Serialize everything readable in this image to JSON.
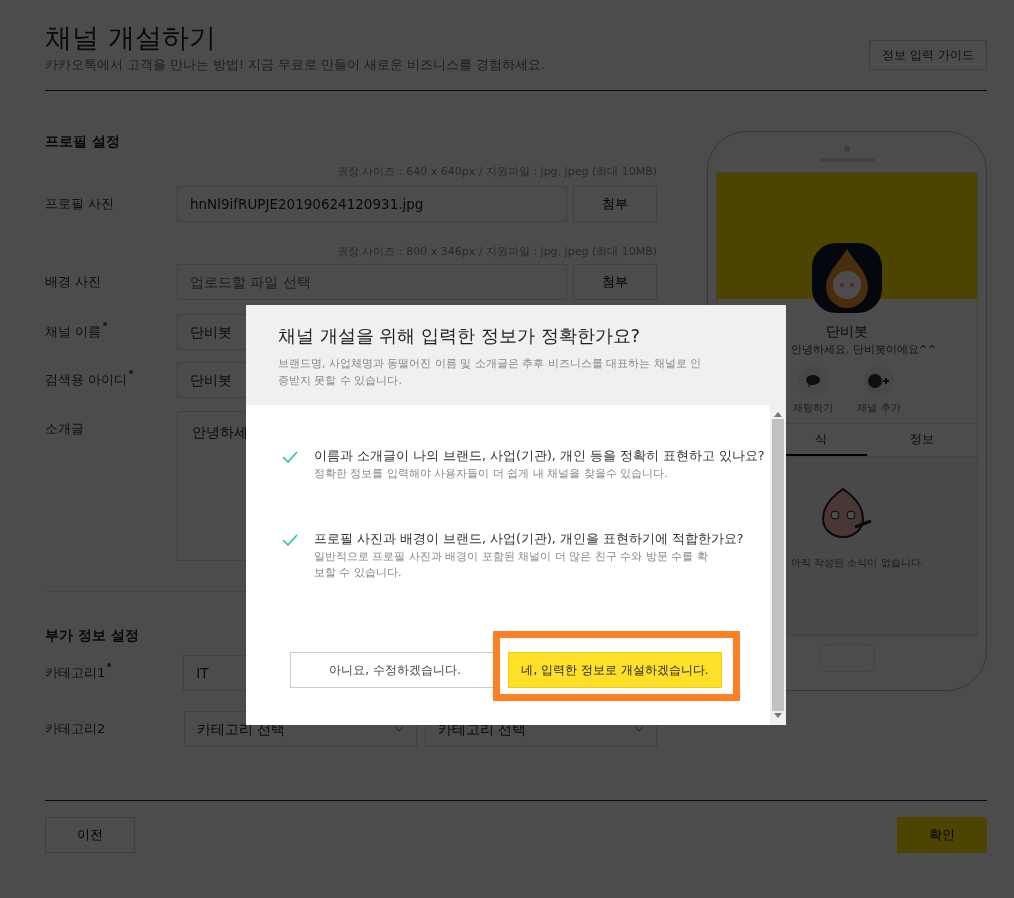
{
  "page": {
    "title": "채널 개설하기",
    "subtitle": "카카오톡에서 고객을 만나는 방법! 지금 무료로 만들어 새로운 비즈니스를 경험하세요.",
    "guide_button": "정보 입력 가이드"
  },
  "profile_section": {
    "heading": "프로필 설정",
    "fields": [
      {
        "kind": "file",
        "label": "프로필 사진",
        "required": false,
        "hint": "권장 사이즈 : 640 x 640px / 지원파일 : jpg, jpeg (최대 10MB)",
        "value": "hnNl9ifRUPJE20190624120931.jpg",
        "button": "첨부"
      },
      {
        "kind": "file",
        "label": "배경 사진",
        "required": false,
        "hint": "권장 사이즈 : 800 x 346px / 지원파일 : jpg, jpeg (최대 10MB)",
        "placeholder": "업로드할 파일 선택",
        "button": "첨부"
      },
      {
        "kind": "text",
        "label": "채널 이름",
        "required": true,
        "value": "단비봇"
      },
      {
        "kind": "text",
        "label": "검색용 아이디",
        "required": true,
        "value": "단비봇"
      },
      {
        "kind": "textarea",
        "label": "소개글",
        "required": false,
        "value": "안녕하세"
      }
    ]
  },
  "extra_section": {
    "heading": "부가 정보 설정",
    "fields": [
      {
        "kind": "select",
        "label": "카테고리1",
        "required": true,
        "selects": [
          "IT"
        ]
      },
      {
        "kind": "select",
        "label": "카테고리2",
        "required": false,
        "selects": [
          "카테고리 선택",
          "카테고리 선택"
        ]
      }
    ]
  },
  "footer": {
    "prev_button": "이전",
    "confirm_button": "확인"
  },
  "preview": {
    "name": "단비봇",
    "greeting": "안녕하세요. 단비봇이에요^^",
    "actions": [
      {
        "kind": "chat",
        "label": "채팅하기"
      },
      {
        "kind": "add",
        "label": "채널 추가"
      }
    ],
    "tabs": [
      {
        "label": "식",
        "selected": true
      },
      {
        "label": "정보",
        "selected": false
      }
    ],
    "empty_message": "아직 작성된 소식이 없습니다."
  },
  "dialog": {
    "title": "채널 개설을 위해 입력한 정보가 정확한가요?",
    "description": "브랜드명, 사업체명과 동떨어진 이름 및 소개글은 추후 비즈니스를 대표하는 채널로 인증받지 못할 수 있습니다.",
    "checks": [
      {
        "checked": true,
        "title": "이름과 소개글이 나의 브랜드, 사업(기관), 개인 등을 정확히 표현하고 있나요?",
        "detail": "정확한 정보를 입력해야 사용자들이 더 쉽게 내 채널을 찾을수 있습니다."
      },
      {
        "checked": true,
        "title": "프로필 사진과 배경이 브랜드, 사업(기관), 개인을 표현하기에 적합한가요?",
        "detail": "일반적으로 프로필 사진과 배경이 포함된 채널이 더 많은 친구 수와 방문 수를 확보할 수 있습니다."
      }
    ],
    "buttons": [
      {
        "kind": "secondary",
        "label": "아니요, 수정하겠습니다.",
        "highlighted": false
      },
      {
        "kind": "primary",
        "label": "네, 입력한 정보로 개설하겠습니다.",
        "highlighted": true
      }
    ]
  }
}
